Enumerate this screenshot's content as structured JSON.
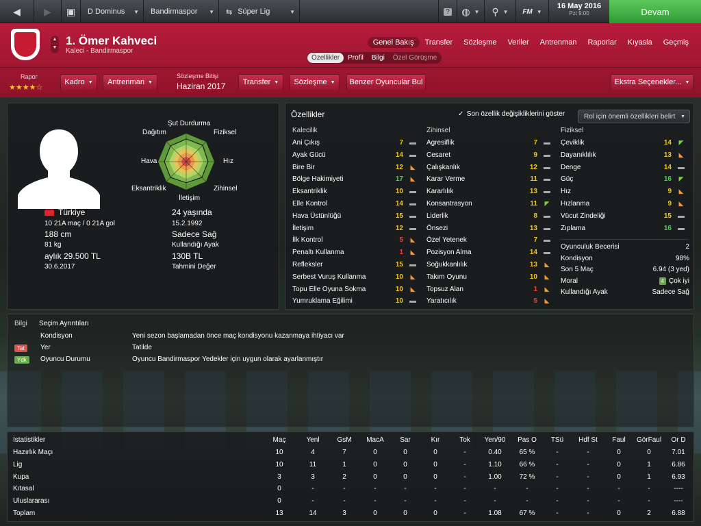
{
  "topbar": {
    "manager": "D Dominus",
    "club": "Bandirmaspor",
    "league": "Süper Lig",
    "date": "16 May 2016",
    "time": "Pzt 9:00",
    "continue": "Devam",
    "fm_label": "FM"
  },
  "player": {
    "name": "1. Ömer Kahveci",
    "role": "Kaleci - Bandirmaspor"
  },
  "nav_tabs": [
    "Genel Bakış",
    "Transfer",
    "Sözleşme",
    "Veriler",
    "Antrenman",
    "Raporlar",
    "Kıyasla",
    "Geçmiş"
  ],
  "sub_tabs": [
    "Özellikler",
    "Profil",
    "Bilgi",
    "Özel Görüşme"
  ],
  "header_row": {
    "rapor_label": "Rapor",
    "stars": "★★★★☆",
    "kadro": "Kadro",
    "antrenman": "Antrenman",
    "contract_label": "Sözleşme Bitişi",
    "contract_value": "Haziran 2017",
    "transfer": "Transfer",
    "sozlesme": "Sözleşme",
    "similar": "Benzer Oyuncular Bul",
    "extra": "Ekstra Seçenekler..."
  },
  "profile": {
    "nation": "Türkiye",
    "caps": "10 21A maç / 0 21A gol",
    "height": "188 cm",
    "weight": "81 kg",
    "wage": "aylık 29.500 TL",
    "contract_end": "30.6.2017",
    "age": "24 yaşında",
    "dob": "15.2.1992",
    "foot": "Sadece Sağ",
    "foot_label": "Kullandığı Ayak",
    "value": "130B TL",
    "value_label": "Tahmini Değer"
  },
  "radar": {
    "labels": [
      "Şut Durdurma",
      "Fiziksel",
      "Hız",
      "Zihinsel",
      "İletişim",
      "Eksantriklik",
      "Hava",
      "Dağıtım"
    ]
  },
  "attributes": {
    "title": "Özellikler",
    "show_changes": "Son özellik değişikliklerini göster",
    "role_dropdown": "Rol için önemli özellikleri belirt",
    "columns": [
      {
        "header": "Kalecilik",
        "items": [
          {
            "name": "Ani Çıkış",
            "value": "7",
            "color": "yellow",
            "trend": "flat"
          },
          {
            "name": "Ayak Gücü",
            "value": "14",
            "color": "yellow",
            "trend": "flat"
          },
          {
            "name": "Bire Bir",
            "value": "12",
            "color": "yellow",
            "trend": "down"
          },
          {
            "name": "Bölge Hakimiyeti",
            "value": "17",
            "color": "green",
            "trend": "down"
          },
          {
            "name": "Eksantriklik",
            "value": "10",
            "color": "yellow",
            "trend": "flat"
          },
          {
            "name": "Elle Kontrol",
            "value": "14",
            "color": "yellow",
            "trend": "flat"
          },
          {
            "name": "Hava Üstünlüğü",
            "value": "15",
            "color": "yellow",
            "trend": "flat"
          },
          {
            "name": "İletişim",
            "value": "12",
            "color": "yellow",
            "trend": "flat"
          },
          {
            "name": "İlk Kontrol",
            "value": "5",
            "color": "red",
            "trend": "down"
          },
          {
            "name": "Penaltı Kullanma",
            "value": "1",
            "color": "red",
            "trend": "down"
          },
          {
            "name": "Refleksler",
            "value": "15",
            "color": "yellow",
            "trend": "flat"
          },
          {
            "name": "Serbest Vuruş Kullanma",
            "value": "10",
            "color": "yellow",
            "trend": "down"
          },
          {
            "name": "Topu Elle Oyuna Sokma",
            "value": "10",
            "color": "yellow",
            "trend": "down"
          },
          {
            "name": "Yumruklama Eğilimi",
            "value": "10",
            "color": "yellow",
            "trend": "flat"
          }
        ]
      },
      {
        "header": "Zihinsel",
        "items": [
          {
            "name": "Agresiflik",
            "value": "7",
            "color": "yellow",
            "trend": "flat"
          },
          {
            "name": "Cesaret",
            "value": "9",
            "color": "yellow",
            "trend": "flat"
          },
          {
            "name": "Çalışkanlık",
            "value": "12",
            "color": "yellow",
            "trend": "flat"
          },
          {
            "name": "Karar Verme",
            "value": "11",
            "color": "yellow",
            "trend": "flat"
          },
          {
            "name": "Kararlılık",
            "value": "13",
            "color": "yellow",
            "trend": "flat"
          },
          {
            "name": "Konsantrasyon",
            "value": "11",
            "color": "yellow",
            "trend": "up"
          },
          {
            "name": "Liderlik",
            "value": "8",
            "color": "yellow",
            "trend": "flat"
          },
          {
            "name": "Önsezi",
            "value": "13",
            "color": "yellow",
            "trend": "flat"
          },
          {
            "name": "Özel Yetenek",
            "value": "7",
            "color": "yellow",
            "trend": "flat"
          },
          {
            "name": "Pozisyon Alma",
            "value": "14",
            "color": "yellow",
            "trend": "flat"
          },
          {
            "name": "Soğukkanlılık",
            "value": "13",
            "color": "yellow",
            "trend": "down"
          },
          {
            "name": "Takım Oyunu",
            "value": "10",
            "color": "yellow",
            "trend": "down"
          },
          {
            "name": "Topsuz Alan",
            "value": "1",
            "color": "red",
            "trend": "down"
          },
          {
            "name": "Yaratıcılık",
            "value": "5",
            "color": "red",
            "trend": "down"
          }
        ]
      },
      {
        "header": "Fiziksel",
        "items": [
          {
            "name": "Çeviklik",
            "value": "14",
            "color": "yellow",
            "trend": "up"
          },
          {
            "name": "Dayanıklılık",
            "value": "13",
            "color": "yellow",
            "trend": "down"
          },
          {
            "name": "Denge",
            "value": "14",
            "color": "yellow",
            "trend": "flat"
          },
          {
            "name": "Güç",
            "value": "16",
            "color": "green",
            "trend": "up"
          },
          {
            "name": "Hız",
            "value": "9",
            "color": "yellow",
            "trend": "down"
          },
          {
            "name": "Hızlanma",
            "value": "9",
            "color": "yellow",
            "trend": "down"
          },
          {
            "name": "Vücut Zindeliği",
            "value": "15",
            "color": "yellow",
            "trend": "flat"
          },
          {
            "name": "Zıplama",
            "value": "16",
            "color": "green",
            "trend": "flat"
          }
        ]
      }
    ],
    "summary": [
      {
        "label": "Oyunculuk Becerisi",
        "value": "2"
      },
      {
        "label": "Kondisyon",
        "value": "98%"
      },
      {
        "label": "Son 5 Maç",
        "value": "6.94 (3 yed)"
      },
      {
        "label": "Moral",
        "value": "Çok iyi",
        "badge": "4"
      },
      {
        "label": "Kullandığı Ayak",
        "value": "Sadece Sağ"
      }
    ]
  },
  "info": {
    "tab1": "Bilgi",
    "tab2": "Seçim Ayrıntıları",
    "rows": [
      {
        "badge": "",
        "badge_color": "",
        "label": "Kondisyon",
        "text": "Yeni sezon başlamadan önce maç kondisyonu kazanmaya ihtiyacı var"
      },
      {
        "badge": "Tat",
        "badge_color": "#d9534f",
        "label": "Yer",
        "text": "Tatilde"
      },
      {
        "badge": "Ydk",
        "badge_color": "#6aa84f",
        "label": "Oyuncu Durumu",
        "text": "Oyuncu Bandirmaspor Yedekler için uygun olarak ayarlanmıştır"
      }
    ]
  },
  "stats": {
    "title": "İstatistikler",
    "headers": [
      "Maç",
      "Yenl",
      "GsM",
      "MacA",
      "Sar",
      "Kır",
      "Tok",
      "Yen/90",
      "Pas O",
      "TSü",
      "Hdf St",
      "Faul",
      "GörFaul",
      "Or D"
    ],
    "rows": [
      {
        "label": "Hazırlık Maçı",
        "values": [
          "10",
          "4",
          "7",
          "0",
          "0",
          "0",
          "-",
          "0.40",
          "65 %",
          "-",
          "-",
          "0",
          "0",
          "7.01"
        ]
      },
      {
        "label": "Lig",
        "values": [
          "10",
          "11",
          "1",
          "0",
          "0",
          "0",
          "-",
          "1.10",
          "66 %",
          "-",
          "-",
          "0",
          "1",
          "6.86"
        ]
      },
      {
        "label": "Kupa",
        "values": [
          "3",
          "3",
          "2",
          "0",
          "0",
          "0",
          "-",
          "1.00",
          "72 %",
          "-",
          "-",
          "0",
          "1",
          "6.93"
        ]
      },
      {
        "label": "Kıtasal",
        "values": [
          "0",
          "-",
          "-",
          "-",
          "-",
          "-",
          "-",
          "-",
          "-",
          "-",
          "-",
          "-",
          "-",
          "----"
        ]
      },
      {
        "label": "Uluslararası",
        "values": [
          "0",
          "-",
          "-",
          "-",
          "-",
          "-",
          "-",
          "-",
          "-",
          "-",
          "-",
          "-",
          "-",
          "----"
        ]
      },
      {
        "label": "Toplam",
        "values": [
          "13",
          "14",
          "3",
          "0",
          "0",
          "0",
          "-",
          "1.08",
          "67 %",
          "-",
          "-",
          "0",
          "2",
          "6.88"
        ]
      }
    ]
  }
}
